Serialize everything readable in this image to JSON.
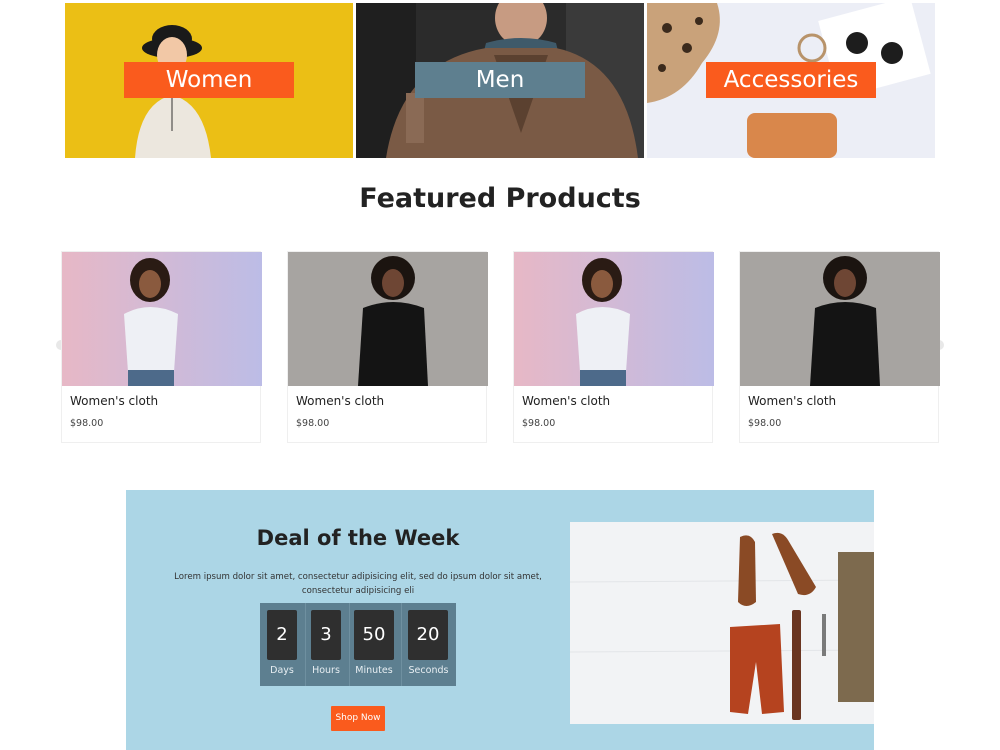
{
  "categories": [
    {
      "label": "Women"
    },
    {
      "label": "Men"
    },
    {
      "label": "Accessories"
    }
  ],
  "featured": {
    "title": "Featured Products",
    "products": [
      {
        "name": "Women's cloth",
        "price": "$98.00"
      },
      {
        "name": "Women's cloth",
        "price": "$98.00"
      },
      {
        "name": "Women's cloth",
        "price": "$98.00"
      },
      {
        "name": "Women's cloth",
        "price": "$98.00"
      }
    ]
  },
  "deal": {
    "title": "Deal of the Week",
    "description": "Lorem ipsum dolor sit amet, consectetur adipisicing elit, sed do ipsum dolor sit amet, consectetur adipisicing eli",
    "countdown": [
      {
        "value": "2",
        "label": "Days"
      },
      {
        "value": "3",
        "label": "Hours"
      },
      {
        "value": "50",
        "label": "Minutes"
      },
      {
        "value": "20",
        "label": "Seconds"
      }
    ],
    "button": "Shop Now"
  },
  "colors": {
    "accent": "#fa5b1d",
    "slate": "#5e7f8f",
    "deal_bg": "#acd6e6"
  }
}
